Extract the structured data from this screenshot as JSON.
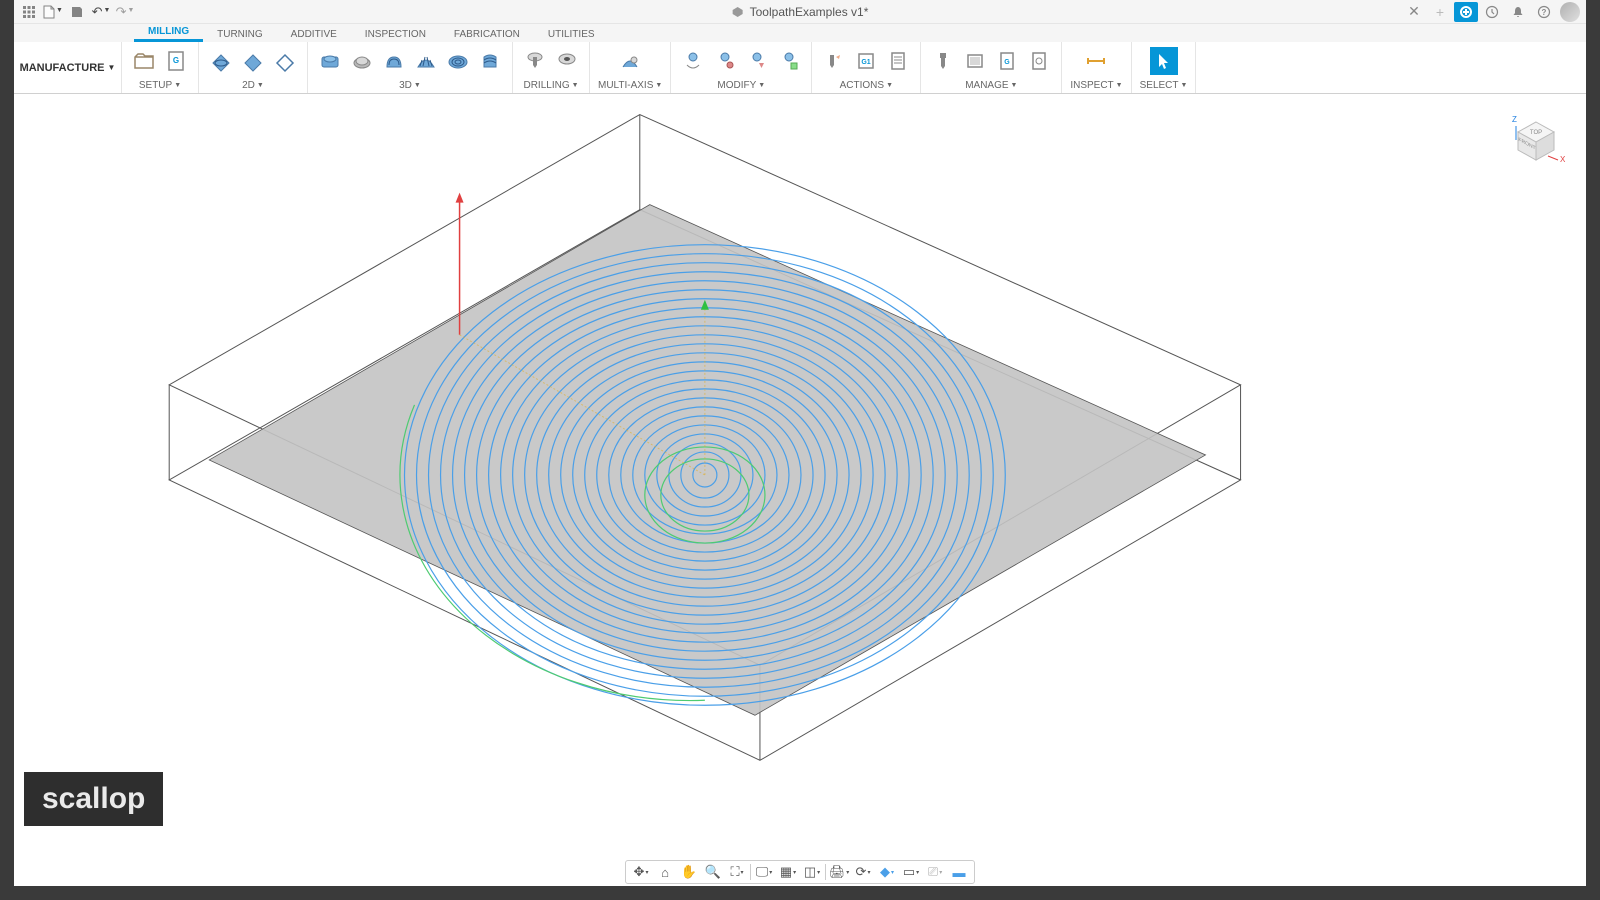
{
  "title": "ToolpathExamples v1*",
  "workspace": "MANUFACTURE",
  "tabs": [
    {
      "label": "MILLING",
      "active": true
    },
    {
      "label": "TURNING",
      "active": false
    },
    {
      "label": "ADDITIVE",
      "active": false
    },
    {
      "label": "INSPECTION",
      "active": false
    },
    {
      "label": "FABRICATION",
      "active": false
    },
    {
      "label": "UTILITIES",
      "active": false
    }
  ],
  "ribbon_groups": [
    "SETUP",
    "2D",
    "3D",
    "DRILLING",
    "MULTI-AXIS",
    "MODIFY",
    "ACTIONS",
    "MANAGE",
    "INSPECT",
    "SELECT"
  ],
  "annotation": "scallop",
  "viewcube": {
    "top": "TOP",
    "front": "FRONT",
    "right": "RIGHT",
    "axes": [
      "X",
      "Z"
    ]
  }
}
